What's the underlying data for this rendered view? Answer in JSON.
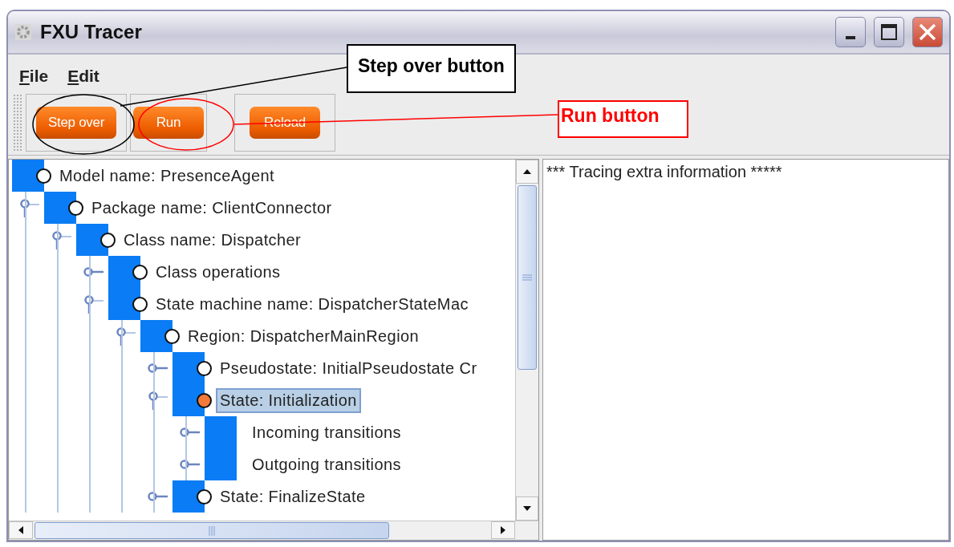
{
  "window": {
    "title": "FXU Tracer"
  },
  "menu": [
    {
      "label": "File"
    },
    {
      "label": "Edit"
    }
  ],
  "toolbar": {
    "buttons": [
      "Step over",
      "Run",
      "Reload"
    ]
  },
  "tree": [
    {
      "label": "Model name: PresenceAgent",
      "kind": "circle",
      "current": false,
      "selected": false,
      "children": [
        {
          "label": "Package name: ClientConnector",
          "kind": "circle",
          "current": false,
          "selected": false,
          "expanded": true,
          "children": [
            {
              "label": "Class name: Dispatcher",
              "kind": "circle",
              "current": false,
              "selected": false,
              "expanded": true,
              "children": [
                {
                  "label": "Class operations",
                  "kind": "circle",
                  "current": false,
                  "selected": false,
                  "expanded": false
                },
                {
                  "label": "State machine name: DispatcherStateMac",
                  "kind": "circle",
                  "current": false,
                  "selected": false,
                  "expanded": true,
                  "children": [
                    {
                      "label": "Region: DispatcherMainRegion",
                      "kind": "circle",
                      "current": false,
                      "selected": false,
                      "expanded": true,
                      "children": [
                        {
                          "label": "Pseudostate: InitialPseudostate Cr",
                          "kind": "circle",
                          "current": false,
                          "selected": false,
                          "expanded": false
                        },
                        {
                          "label": "State: Initialization",
                          "kind": "circle",
                          "current": true,
                          "selected": true,
                          "expanded": true,
                          "children": [
                            {
                              "label": "Incoming transitions",
                              "kind": "plain",
                              "selected": false,
                              "expanded": false
                            },
                            {
                              "label": "Outgoing transitions",
                              "kind": "plain",
                              "selected": false,
                              "expanded": false
                            }
                          ]
                        },
                        {
                          "label": "State: FinalizeState",
                          "kind": "circle",
                          "current": false,
                          "selected": false,
                          "expanded": false
                        }
                      ]
                    }
                  ]
                }
              ]
            }
          ]
        }
      ]
    }
  ],
  "trace_panel": {
    "text": "*** Tracing extra information *****"
  },
  "annotations": [
    {
      "text": "Step over button",
      "color": "#000000"
    },
    {
      "text": "Run button",
      "color": "#ff0000"
    }
  ]
}
